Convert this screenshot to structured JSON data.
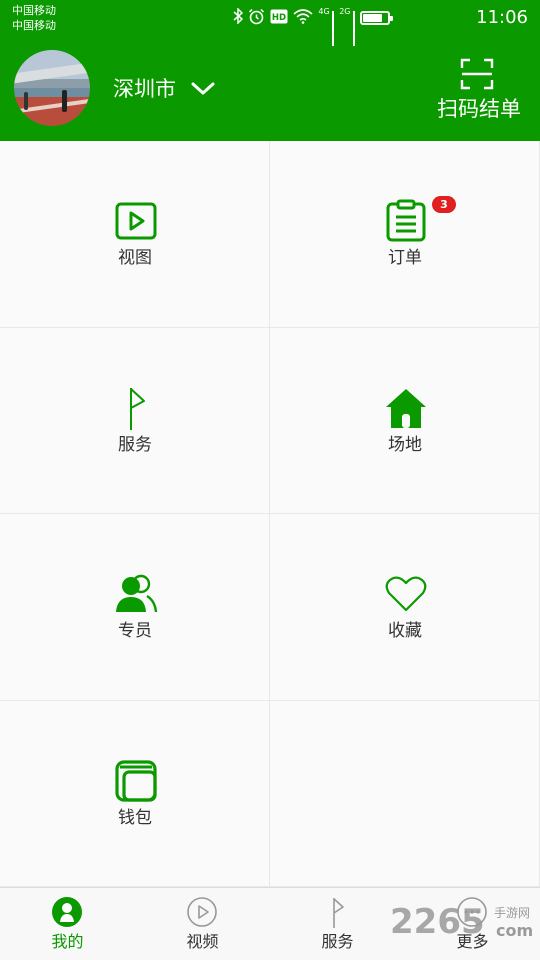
{
  "status_bar": {
    "carrier_1": "中国移动",
    "carrier_2": "中国移动",
    "network_1": "4G",
    "network_2": "2G",
    "hd": "HD",
    "time": "11:06",
    "battery_level": 0.8,
    "icons": [
      "bluetooth-icon",
      "alarm-icon",
      "hd-icon",
      "wifi-icon",
      "signal-icon",
      "signal-icon",
      "battery-icon"
    ]
  },
  "header": {
    "city": "深圳市",
    "scan_label": "扫码结单",
    "background": "#0b9900"
  },
  "grid": {
    "items": [
      {
        "label": "视图",
        "icon": "video-play-icon"
      },
      {
        "label": "订单",
        "icon": "clipboard-icon",
        "badge": "3"
      },
      {
        "label": "服务",
        "icon": "flag-icon"
      },
      {
        "label": "场地",
        "icon": "home-icon"
      },
      {
        "label": "专员",
        "icon": "users-icon"
      },
      {
        "label": "收藏",
        "icon": "heart-icon"
      },
      {
        "label": "钱包",
        "icon": "wallet-icon"
      }
    ]
  },
  "nav": {
    "tabs": [
      {
        "label": "我的",
        "icon": "user-icon",
        "active": true
      },
      {
        "label": "视频",
        "icon": "play-circle-icon",
        "active": false
      },
      {
        "label": "服务",
        "icon": "flag-icon",
        "active": false
      },
      {
        "label": "更多",
        "icon": "more-icon",
        "active": false
      }
    ]
  },
  "watermark": {
    "number": "2265",
    "site": "手游网",
    "domain": "com"
  },
  "colors": {
    "accent": "#0b9900",
    "badge": "#e02020",
    "text": "#333333"
  }
}
